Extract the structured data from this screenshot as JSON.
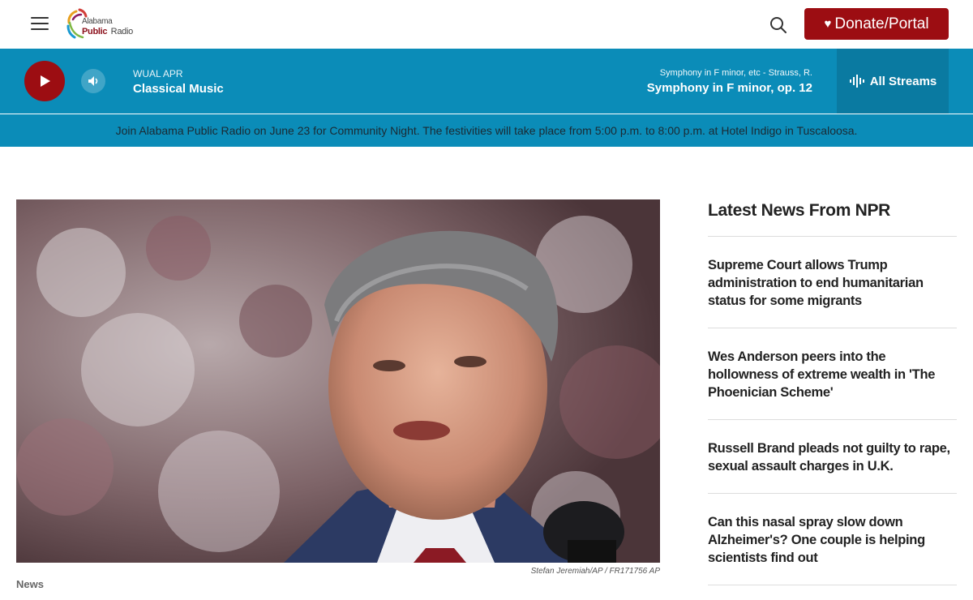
{
  "header": {
    "logo_line1": "Alabama",
    "logo_line2a": "Public",
    "logo_line2b": "Radio",
    "donate_label": "Donate/Portal"
  },
  "player": {
    "station_call": "WUAL APR",
    "station_name": "Classical Music",
    "now_playing_subtitle": "Symphony in F minor, etc - Strauss, R.",
    "now_playing_title": "Symphony in F minor, op. 12",
    "streams_label": "All Streams"
  },
  "announcement": "Join Alabama Public Radio on June 23 for Community Night. The festivities will take place from 5:00 p.m. to 8:00 p.m. at Hotel Indigo in Tuscaloosa.",
  "hero": {
    "caption": "Stefan Jeremiah/AP  /  FR171756 AP",
    "section": "News"
  },
  "sidebar": {
    "title": "Latest News From NPR",
    "items": [
      "Supreme Court allows Trump administration to end humanitarian status for some migrants",
      "Wes Anderson peers into the hollowness of extreme wealth in 'The Phoenician Scheme'",
      "Russell Brand pleads not guilty to rape, sexual assault charges in U.K.",
      "Can this nasal spray slow down Alzheimer's? One couple is helping scientists find out"
    ]
  },
  "colors": {
    "brand_red": "#9c0d12",
    "player_blue": "#0b8cb8",
    "streams_blue": "#0a7aa1"
  }
}
